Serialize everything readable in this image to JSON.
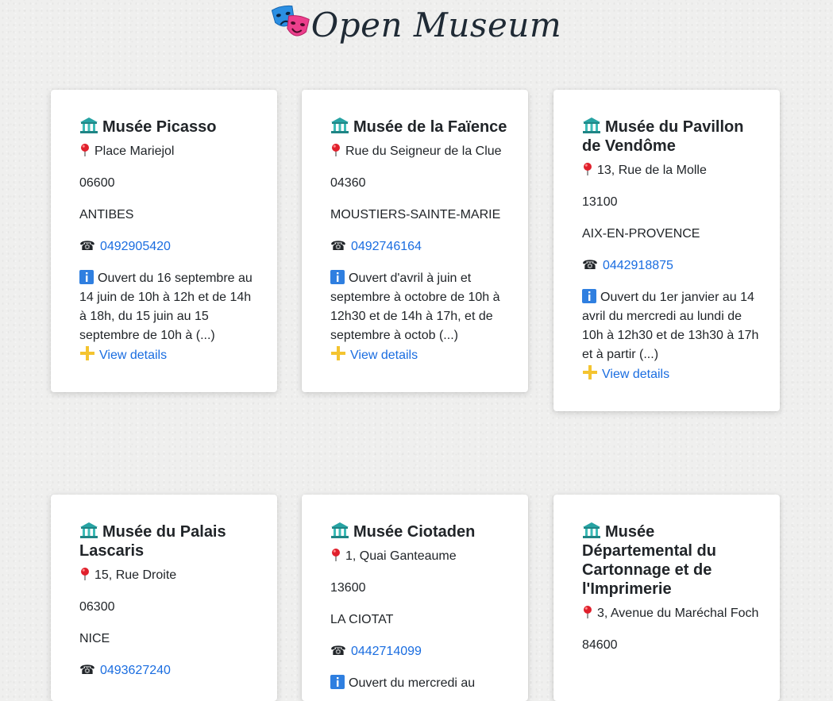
{
  "header": {
    "title": "Open Museum",
    "logo_icon": "theater-masks-icon"
  },
  "icons": {
    "museum": "classical-building-icon",
    "address": "round-pushpin-icon",
    "phone": "telephone-icon",
    "info": "information-icon",
    "details": "plus-icon"
  },
  "museums": [
    {
      "name": "Musée Picasso",
      "address": "Place Mariejol",
      "postcode": "06600",
      "city": "ANTIBES",
      "phone": "0492905420",
      "info": "Ouvert du 16 septembre au 14 juin de 10h à 12h et de 14h à 18h, du 15 juin au 15 septembre de 10h à (...)",
      "details_label": "View details"
    },
    {
      "name": "Musée de la Faïence",
      "address": "Rue du Seigneur de la Clue",
      "postcode": "04360",
      "city": "MOUSTIERS-SAINTE-MARIE",
      "phone": "0492746164",
      "info": "Ouvert d'avril à juin et septembre à octobre de 10h à 12h30 et de 14h à 17h, et de septembre à octob (...)",
      "details_label": "View details"
    },
    {
      "name": "Musée du Pavillon de Vendôme",
      "address": "13, Rue de la Molle",
      "postcode": "13100",
      "city": "AIX-EN-PROVENCE",
      "phone": "0442918875",
      "info": "Ouvert du 1er janvier au 14 avril du mercredi au lundi de 10h à 12h30 et de 13h30 à 17h et à partir (...)",
      "details_label": "View details"
    },
    {
      "name": "Musée du Palais Lascaris",
      "address": "15, Rue Droite",
      "postcode": "06300",
      "city": "NICE",
      "phone": "0493627240",
      "info": "",
      "details_label": ""
    },
    {
      "name": "Musée Ciotaden",
      "address": "1, Quai Ganteaume",
      "postcode": "13600",
      "city": "LA CIOTAT",
      "phone": "0442714099",
      "info": "Ouvert du mercredi au",
      "details_label": ""
    },
    {
      "name": "Musée Départemental du Cartonnage et de l'Imprimerie",
      "address": "3, Avenue du Maréchal Foch",
      "postcode": "84600",
      "city": "",
      "phone": "",
      "info": "",
      "details_label": ""
    }
  ]
}
